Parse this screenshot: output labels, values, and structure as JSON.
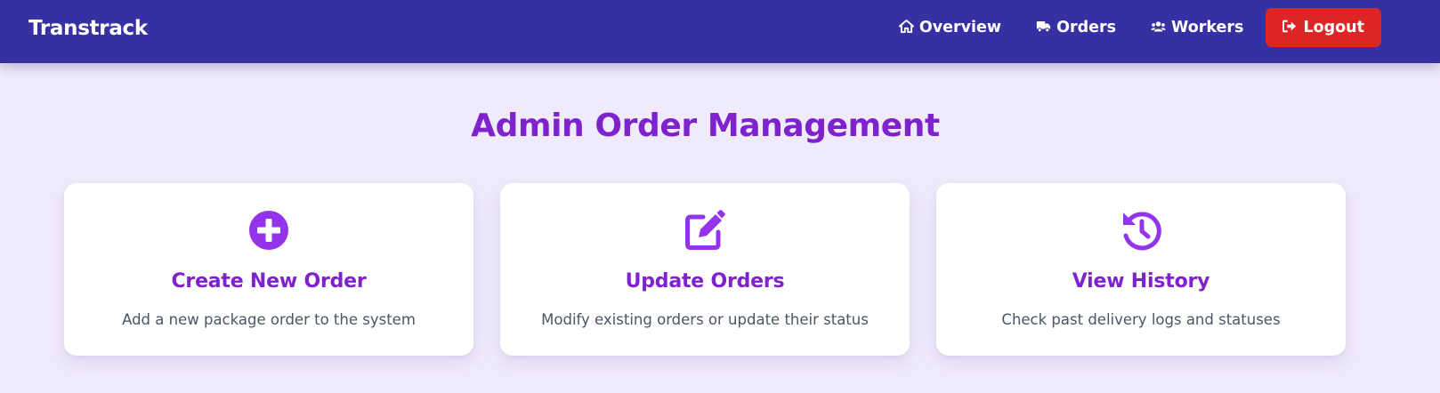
{
  "app": {
    "brand": "Transtrack",
    "accent_color": "#7e22ce",
    "nav_color": "#3730a3",
    "logout_color": "#dc2626"
  },
  "nav": {
    "items": [
      {
        "label": "Overview",
        "icon": "home-icon"
      },
      {
        "label": "Orders",
        "icon": "truck-icon"
      },
      {
        "label": "Workers",
        "icon": "users-icon"
      }
    ],
    "logout": {
      "label": "Logout",
      "icon": "sign-out-icon"
    }
  },
  "main": {
    "title": "Admin Order Management",
    "cards": [
      {
        "title": "Create New Order",
        "description": "Add a new package order to the system",
        "icon": "plus-circle-icon"
      },
      {
        "title": "Update Orders",
        "description": "Modify existing orders or update their status",
        "icon": "edit-icon"
      },
      {
        "title": "View History",
        "description": "Check past delivery logs and statuses",
        "icon": "history-icon"
      }
    ]
  }
}
